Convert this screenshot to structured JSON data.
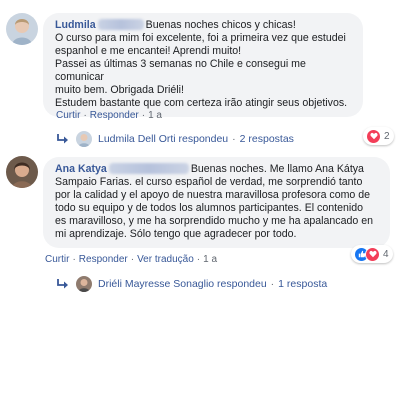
{
  "comments": [
    {
      "author": "Ludmila",
      "text_lines": [
        "Buenas noches chicos y chicas!",
        "O curso para mim foi excelente, foi a primeira vez que estudei",
        "espanhol e me encantei! Aprendi muito!",
        "Passei as últimas 3 semanas no Chile e consegui me comunicar",
        "muito bem. Obrigada Driéli!",
        "Estudem bastante que com certeza irão atingir seus objetivos."
      ],
      "actions": [
        "Curtir",
        "Responder",
        "1 a"
      ],
      "reaction_count": "2",
      "replies": {
        "replier": "Ludmila Dell Orti respondeu",
        "count_label": "2 respostas"
      }
    },
    {
      "author": "Ana Katya",
      "text_lines": [
        "Buenas noches. Me llamo Ana Kátya",
        "Sampaio Farias. el curso español de verdad, me sorprendió tanto",
        "por la calidad y el apoyo de nuestra maravillosa profesora como de",
        "todo su equipo y de todos los alumnos participantes. El contenido",
        "es maravilloso, y me ha sorprendido mucho y me ha apalancado en",
        "mi aprendizaje. Sólo tengo que agradecer por todo."
      ],
      "actions": [
        "Curtir",
        "Responder",
        "Ver tradução",
        "1 a"
      ],
      "reaction_count": "4",
      "replies": {
        "replier": "Driéli Mayresse Sonaglio respondeu",
        "count_label": "1 resposta"
      }
    }
  ],
  "colors": {
    "link": "#385898",
    "bubble": "#f2f3f5",
    "love": "#f33e58",
    "like": "#1877f2"
  },
  "icons": {
    "reply_arrow": "reply-arrow-icon",
    "love": "heart-icon",
    "like": "thumbs-up-icon"
  }
}
